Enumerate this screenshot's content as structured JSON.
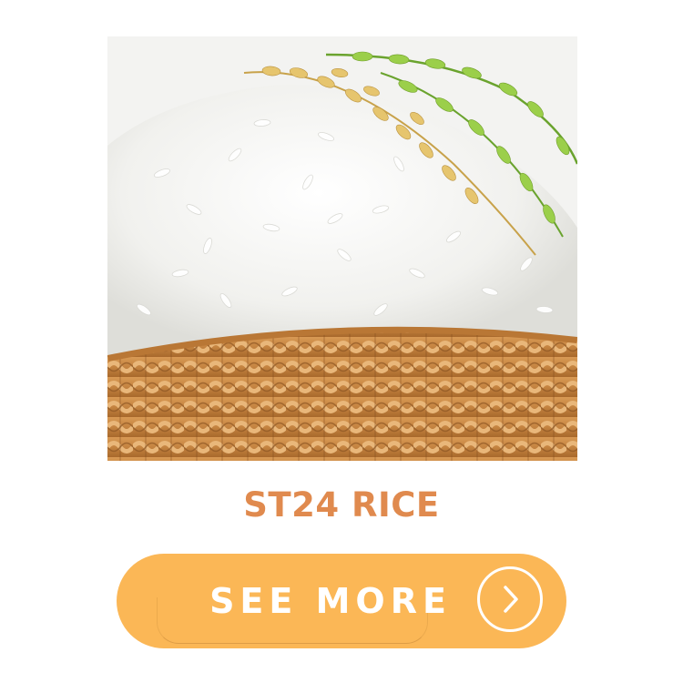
{
  "product": {
    "title": "ST24 RICE",
    "image_icon": "rice-basket-image"
  },
  "cta": {
    "label": "SEE MORE",
    "icon": "chevron-right-icon"
  },
  "colors": {
    "title": "#e08a4e",
    "button_bg": "#fbb756",
    "button_text": "#ffffff"
  }
}
